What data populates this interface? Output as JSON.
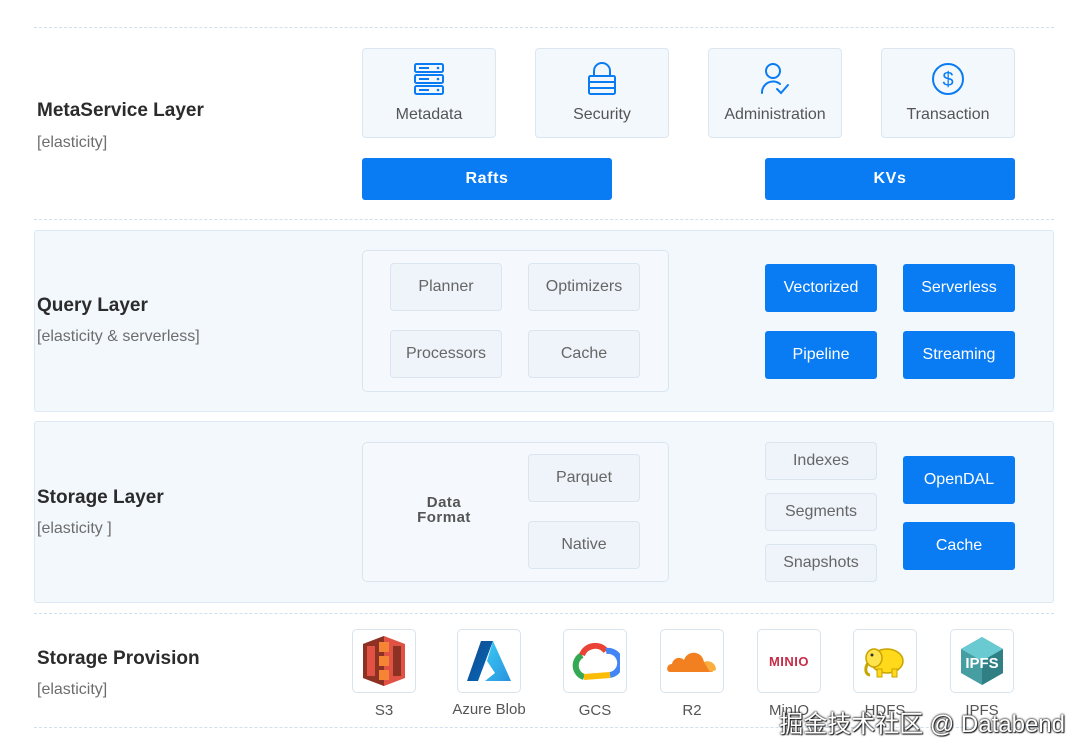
{
  "meta": {
    "title": "MetaService Layer",
    "subtitle": "[elasticity]",
    "tiles": [
      {
        "label": "Metadata",
        "icon": "server-stack-icon"
      },
      {
        "label": "Security",
        "icon": "lock-icon"
      },
      {
        "label": "Administration",
        "icon": "user-check-icon"
      },
      {
        "label": "Transaction",
        "icon": "dollar-circle-icon"
      }
    ],
    "buttons": [
      "Rafts",
      "KVs"
    ]
  },
  "query": {
    "title": "Query Layer",
    "subtitle": "[elasticity & serverless]",
    "chips": [
      "Planner",
      "Optimizers",
      "Processors",
      "Cache"
    ],
    "features": [
      "Vectorized",
      "Serverless",
      "Pipeline",
      "Streaming"
    ]
  },
  "storage": {
    "title": "Storage Layer",
    "subtitle": "[elasticity ]",
    "data_format_line1": "Data",
    "data_format_line2": "Format",
    "formats": [
      "Parquet",
      "Native"
    ],
    "objects": [
      "Indexes",
      "Segments",
      "Snapshots"
    ],
    "features": [
      "OpenDAL",
      "Cache"
    ]
  },
  "provision": {
    "title": "Storage Provision",
    "subtitle": "[elasticity]",
    "providers": [
      {
        "label": "S3",
        "icon": "aws-s3-icon"
      },
      {
        "label": "Azure Blob",
        "icon": "azure-icon"
      },
      {
        "label": "GCS",
        "icon": "google-cloud-icon"
      },
      {
        "label": "R2",
        "icon": "cloudflare-icon"
      },
      {
        "label": "MinIO",
        "icon": "minio-icon",
        "logo_text": "MINIO"
      },
      {
        "label": "HDFS",
        "icon": "hadoop-elephant-icon"
      },
      {
        "label": "IPFS",
        "icon": "ipfs-cube-icon",
        "logo_text": "IPFS"
      }
    ]
  },
  "watermark": "掘金技术社区 @ Databend",
  "colors": {
    "accent": "#0a7cf3",
    "panel": "#f3f8fd",
    "border": "#dde9f4"
  }
}
